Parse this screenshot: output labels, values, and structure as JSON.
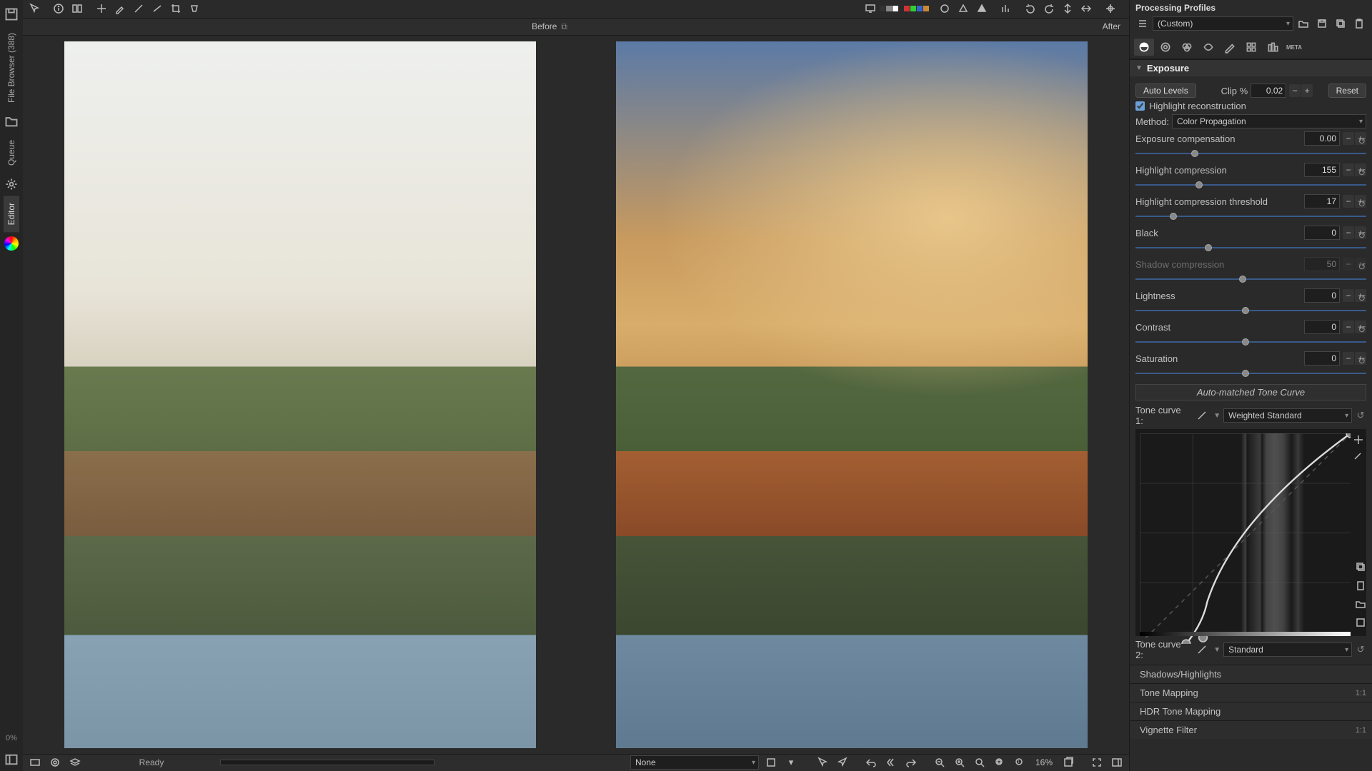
{
  "leftRail": {
    "tabs": [
      "File Browser (388)",
      "Queue",
      "Editor"
    ],
    "progress": "0%"
  },
  "topToolbar": {
    "icons": [
      "pin",
      "info",
      "window",
      "crosshair",
      "picker",
      "pencil",
      "line",
      "crop",
      "rotate"
    ]
  },
  "compare": {
    "before": "Before",
    "after": "After"
  },
  "statusBar": {
    "ready": "Ready",
    "colorProfile": "None",
    "zoom": "16%"
  },
  "profilesPanel": {
    "title": "Processing Profiles",
    "current": "(Custom)"
  },
  "toolTabs": [
    "exposure",
    "detail",
    "color",
    "advanced",
    "transform",
    "raw",
    "meta"
  ],
  "exposure": {
    "title": "Exposure",
    "autoLevels": "Auto Levels",
    "clipLabel": "Clip %",
    "clipValue": "0.02",
    "resetLabel": "Reset",
    "highlightRecon": "Highlight reconstruction",
    "methodLabel": "Method:",
    "methodValue": "Color Propagation",
    "sliders": [
      {
        "label": "Exposure compensation",
        "value": "0.00",
        "pos": 24
      },
      {
        "label": "Highlight compression",
        "value": "155",
        "pos": 26
      },
      {
        "label": "Highlight compression threshold",
        "value": "17",
        "pos": 15
      },
      {
        "label": "Black",
        "value": "0",
        "pos": 30
      },
      {
        "label": "Shadow compression",
        "value": "50",
        "pos": 45,
        "disabled": true
      },
      {
        "label": "Lightness",
        "value": "0",
        "pos": 46
      },
      {
        "label": "Contrast",
        "value": "0",
        "pos": 46
      },
      {
        "label": "Saturation",
        "value": "0",
        "pos": 46
      }
    ],
    "autoMatched": "Auto-matched Tone Curve",
    "toneCurve1Label": "Tone curve 1:",
    "toneCurve1Type": "Weighted Standard",
    "toneCurve2Label": "Tone curve 2:",
    "toneCurve2Type": "Standard"
  },
  "collapsedSections": [
    "Shadows/Highlights",
    "Tone Mapping",
    "HDR Tone Mapping",
    "Vignette Filter"
  ]
}
